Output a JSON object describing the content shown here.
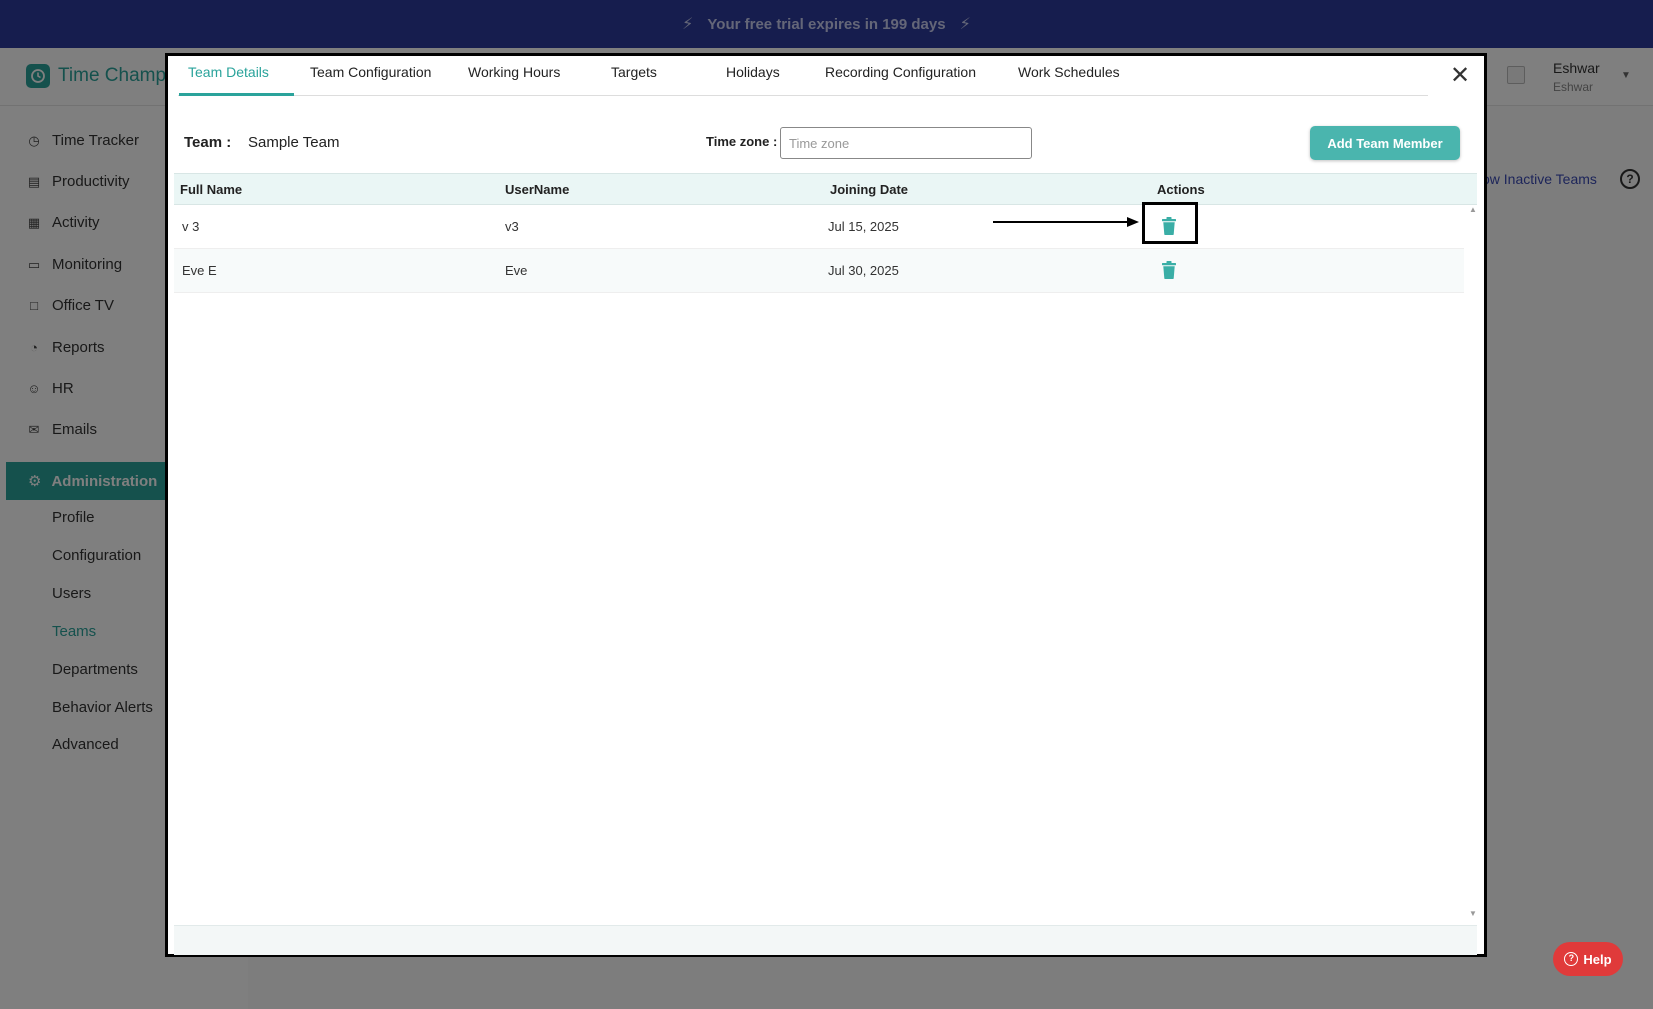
{
  "banner": {
    "text": "Your free trial expires in 199 days"
  },
  "app": {
    "logo_text": "Time Champ"
  },
  "user": {
    "name": "Eshwar",
    "sub": "Eshwar"
  },
  "sidebar": {
    "items": [
      {
        "label": "Time Tracker",
        "icon": "clock-icon"
      },
      {
        "label": "Productivity",
        "icon": "bar-chart-icon"
      },
      {
        "label": "Activity",
        "icon": "activity-icon"
      },
      {
        "label": "Monitoring",
        "icon": "monitor-icon"
      },
      {
        "label": "Office TV",
        "icon": "tv-icon"
      },
      {
        "label": "Reports",
        "icon": "pie-chart-icon"
      },
      {
        "label": "HR",
        "icon": "user-icon"
      },
      {
        "label": "Emails",
        "icon": "mail-icon"
      }
    ],
    "active": {
      "label": "Administration",
      "icon": "gear-icon"
    },
    "sub_items": [
      {
        "label": "Profile"
      },
      {
        "label": "Configuration"
      },
      {
        "label": "Users"
      },
      {
        "label": "Teams"
      },
      {
        "label": "Departments"
      },
      {
        "label": "Behavior Alerts"
      },
      {
        "label": "Advanced"
      }
    ],
    "active_sub": "Teams"
  },
  "background": {
    "inactive_link": "ow Inactive Teams"
  },
  "modal": {
    "tabs": [
      {
        "label": "Team Details"
      },
      {
        "label": "Team Configuration"
      },
      {
        "label": "Working Hours"
      },
      {
        "label": "Targets"
      },
      {
        "label": "Holidays"
      },
      {
        "label": "Recording Configuration"
      },
      {
        "label": "Work Schedules"
      }
    ],
    "active_tab": "Team Details",
    "team_label": "Team :",
    "team_value": "Sample Team",
    "timezone_label": "Time zone :",
    "timezone_placeholder": "Time zone",
    "add_button": "Add Team Member",
    "table": {
      "headers": [
        "Full Name",
        "UserName",
        "Joining Date",
        "Actions"
      ],
      "rows": [
        {
          "full_name": "v 3",
          "username": "v3",
          "joining_date": "Jul 15, 2025"
        },
        {
          "full_name": "Eve E",
          "username": "Eve",
          "joining_date": "Jul 30, 2025"
        }
      ]
    }
  },
  "help_button": "Help",
  "colors": {
    "accent": "#2aa39b",
    "banner": "#2c3b9c",
    "danger": "#e03a3a"
  }
}
